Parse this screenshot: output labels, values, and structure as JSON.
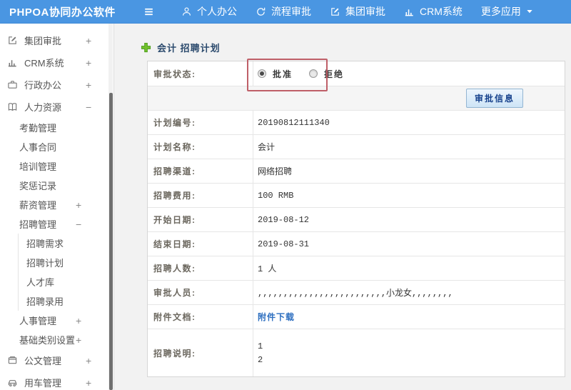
{
  "header": {
    "logo": "PHPOA协同办公软件",
    "nav": [
      {
        "label": "个人办公",
        "icon": "person-icon"
      },
      {
        "label": "流程审批",
        "icon": "process-icon"
      },
      {
        "label": "集团审批",
        "icon": "edit-square-icon"
      },
      {
        "label": "CRM系统",
        "icon": "bar-chart-icon"
      },
      {
        "label": "更多应用",
        "icon": null,
        "caret": true
      }
    ]
  },
  "sidebar": {
    "items": [
      {
        "label": "集团审批",
        "level": 1,
        "icon": "edit-square-icon",
        "expand": "+"
      },
      {
        "label": "CRM系统",
        "level": 1,
        "icon": "bar-chart-icon",
        "expand": "+"
      },
      {
        "label": "行政办公",
        "level": 1,
        "icon": "briefcase-icon",
        "expand": "+"
      },
      {
        "label": "人力资源",
        "level": 1,
        "icon": "book-icon",
        "expand": "−"
      },
      {
        "label": "考勤管理",
        "level": 2
      },
      {
        "label": "人事合同",
        "level": 2
      },
      {
        "label": "培训管理",
        "level": 2
      },
      {
        "label": "奖惩记录",
        "level": 2
      },
      {
        "label": "薪资管理",
        "level": 2,
        "expand": "+"
      },
      {
        "label": "招聘管理",
        "level": 2,
        "expand": "−"
      },
      {
        "label": "招聘需求",
        "level": 3
      },
      {
        "label": "招聘计划",
        "level": 3
      },
      {
        "label": "人才库",
        "level": 3
      },
      {
        "label": "招聘录用",
        "level": 3
      },
      {
        "label": "人事管理",
        "level": 2,
        "expand": "+"
      },
      {
        "label": "基础类别设置",
        "level": 2,
        "expand": "+"
      },
      {
        "label": "公文管理",
        "level": 1,
        "icon": "doc-icon",
        "expand": "+"
      },
      {
        "label": "用车管理",
        "level": 1,
        "icon": "car-icon",
        "expand": "+"
      }
    ]
  },
  "main": {
    "title": "会计 招聘计划",
    "status_row": {
      "label": "审批状态:",
      "options": [
        {
          "label": "批准",
          "checked": true
        },
        {
          "label": "拒绝",
          "checked": false
        }
      ]
    },
    "toolbar": {
      "approve_info_label": "审批信息"
    },
    "fields": [
      {
        "label": "计划编号:",
        "value": "20190812111340"
      },
      {
        "label": "计划名称:",
        "value": "会计"
      },
      {
        "label": "招聘渠道:",
        "value": "网络招聘"
      },
      {
        "label": "招聘费用:",
        "value": "100 RMB"
      },
      {
        "label": "开始日期:",
        "value": "2019-08-12"
      },
      {
        "label": "结束日期:",
        "value": "2019-08-31"
      },
      {
        "label": "招聘人数:",
        "value": "1 人"
      },
      {
        "label": "审批人员:",
        "value": ",,,,,,,,,,,,,,,,,,,,,,,,,小龙女,,,,,,,,"
      },
      {
        "label": "附件文档:",
        "value": "附件下载",
        "link": true
      },
      {
        "label": "招聘说明:",
        "lines": [
          "1",
          "2"
        ],
        "tall": true
      }
    ]
  },
  "colors": {
    "header_blue": "#4a96e2",
    "annotation_red": "#bf5f68",
    "link_blue": "#2e6fc0",
    "button_text_blue": "#16418c",
    "title_navy": "#2b4a6d",
    "plus_green": "#72c02c"
  }
}
